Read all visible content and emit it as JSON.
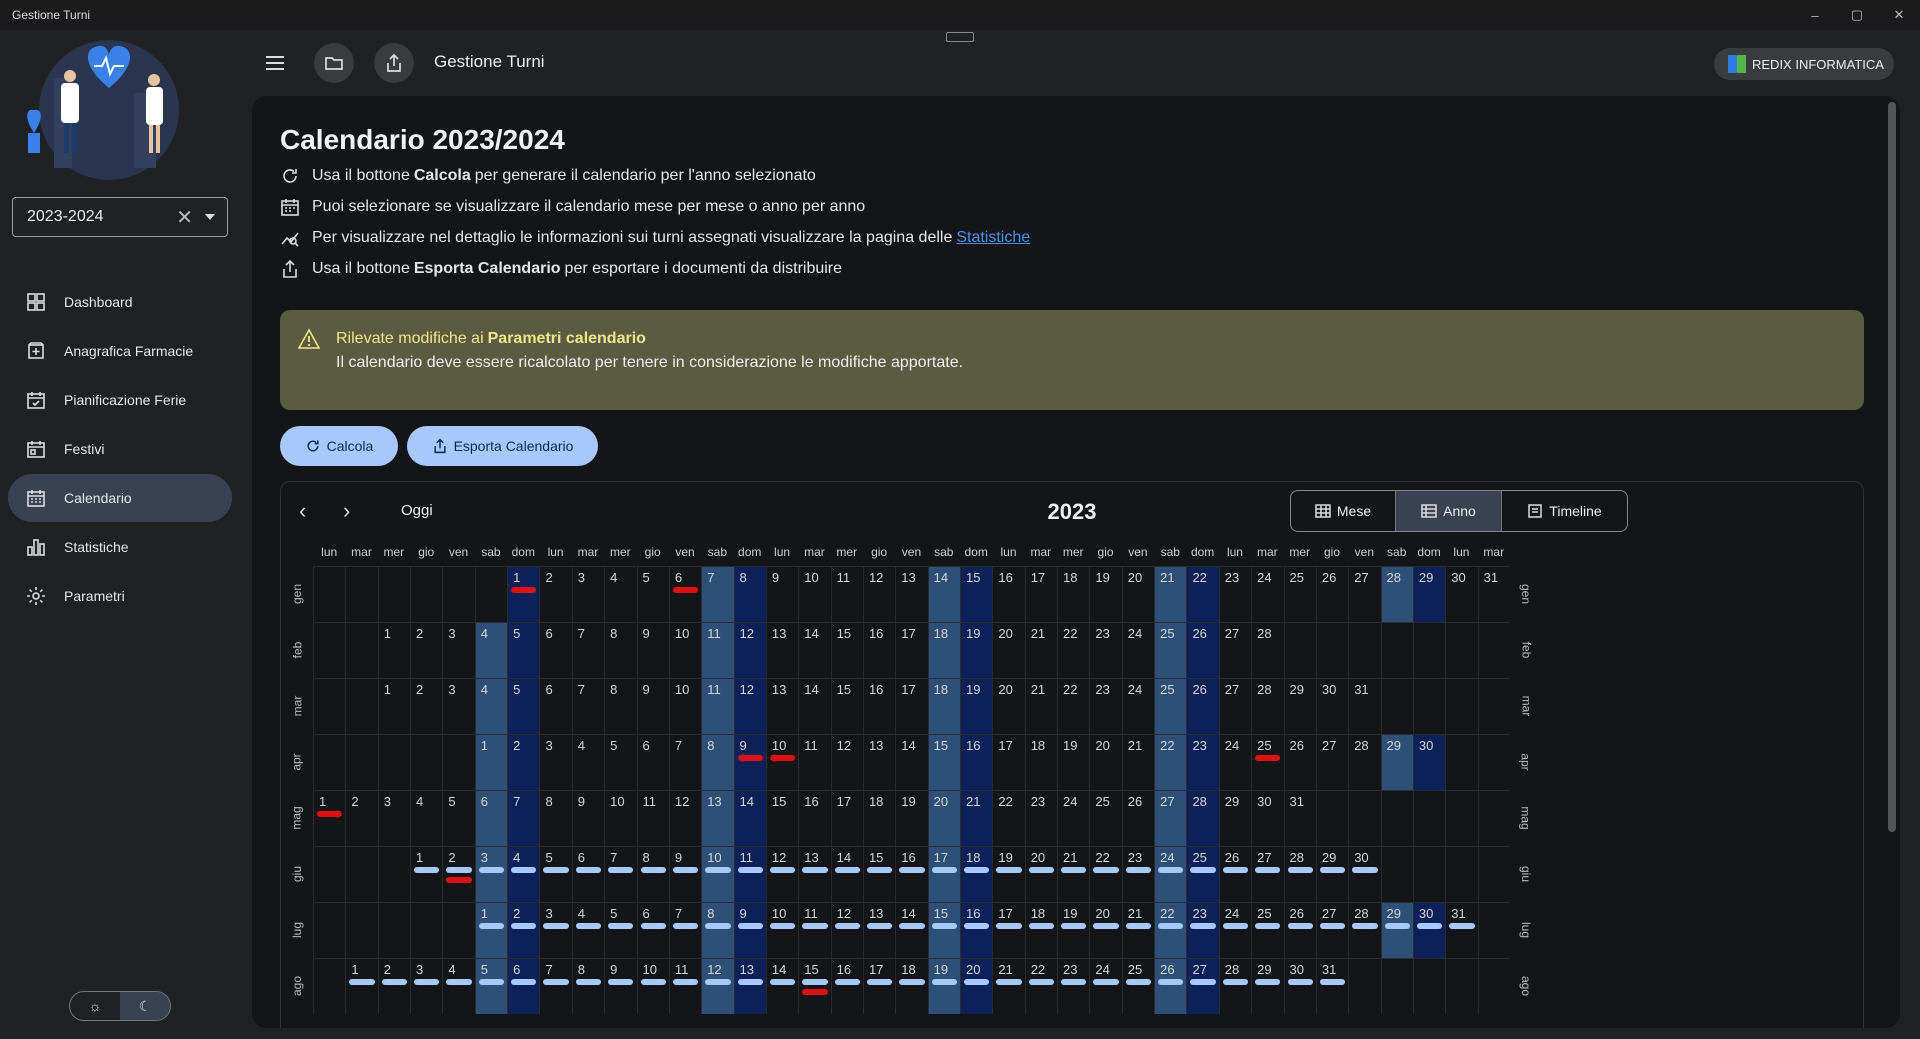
{
  "window": {
    "title": "Gestione Turni",
    "controls": [
      "–",
      "▢",
      "✕"
    ]
  },
  "sidebar": {
    "year_select": {
      "value": "2023-2024",
      "clear_glyph": "✕"
    },
    "items": [
      {
        "label": "Dashboard",
        "icon": "dashboard-icon",
        "active": false
      },
      {
        "label": "Anagrafica Farmacie",
        "icon": "pharmacy-icon",
        "active": false
      },
      {
        "label": "Pianificazione Ferie",
        "icon": "calendar-check-icon",
        "active": false
      },
      {
        "label": "Festivi",
        "icon": "calendar-day-icon",
        "active": false
      },
      {
        "label": "Calendario",
        "icon": "calendar-icon",
        "active": true
      },
      {
        "label": "Statistiche",
        "icon": "bar-chart-icon",
        "active": false
      },
      {
        "label": "Parametri",
        "icon": "gear-icon",
        "active": false
      }
    ],
    "theme": {
      "light_glyph": "☼",
      "dark_glyph": "☾",
      "selected": "dark"
    }
  },
  "topbar": {
    "title": "Gestione Turni",
    "badge": "REDIX INFORMATICA"
  },
  "page": {
    "title": "Calendario 2023/2024",
    "info": [
      {
        "pre": "Usa il bottone",
        "bold": "Calcola",
        "post": "per generare il calendario per l'anno selezionato",
        "link": ""
      },
      {
        "pre": "Puoi selezionare se visualizzare il calendario mese per mese o anno per anno",
        "bold": "",
        "post": "",
        "link": ""
      },
      {
        "pre": "Per visualizzare nel dettaglio le informazioni sui turni assegnati visualizzare la pagina delle",
        "bold": "",
        "post": "",
        "link": "Statistiche"
      },
      {
        "pre": "Usa il bottone",
        "bold": "Esporta Calendario",
        "post": "per esportare i documenti da distribuire",
        "link": ""
      }
    ],
    "warning": {
      "line1_pre": "Rilevate modifiche ai",
      "line1_bold": "Parametri calendario",
      "line2": "Il calendario deve essere ricalcolato per tenere in considerazione le modifiche apportate."
    },
    "buttons": {
      "calcola": "Calcola",
      "esporta": "Esporta Calendario"
    }
  },
  "calendar": {
    "today_label": "Oggi",
    "year": "2023",
    "views": [
      {
        "label": "Mese",
        "active": false
      },
      {
        "label": "Anno",
        "active": true
      },
      {
        "label": "Timeline",
        "active": false
      }
    ],
    "weekday_headers": [
      "lun",
      "mar",
      "mer",
      "gio",
      "ven",
      "sab",
      "dom"
    ],
    "colors": {
      "saturday": "#2e5078",
      "sunday": "#0c2157",
      "shift_bar": "#a8c7fa",
      "holiday_bar": "#e01010"
    },
    "months": [
      {
        "label": "gen",
        "start": 6,
        "days": 31,
        "bars": [],
        "red": [
          1,
          6
        ]
      },
      {
        "label": "feb",
        "start": 2,
        "days": 28,
        "bars": [],
        "red": []
      },
      {
        "label": "mar",
        "start": 2,
        "days": 31,
        "bars": [],
        "red": []
      },
      {
        "label": "apr",
        "start": 5,
        "days": 30,
        "bars": [],
        "red": [
          9,
          10,
          25
        ]
      },
      {
        "label": "mag",
        "start": 0,
        "days": 31,
        "bars": [],
        "red": [
          1
        ]
      },
      {
        "label": "giu",
        "start": 3,
        "days": 30,
        "bars": [
          1,
          30
        ],
        "red": [
          2
        ]
      },
      {
        "label": "lug",
        "start": 5,
        "days": 31,
        "bars": [
          1,
          31
        ],
        "red": []
      },
      {
        "label": "ago",
        "start": 1,
        "days": 31,
        "bars": [
          1,
          31
        ],
        "red": [
          15
        ]
      }
    ]
  }
}
